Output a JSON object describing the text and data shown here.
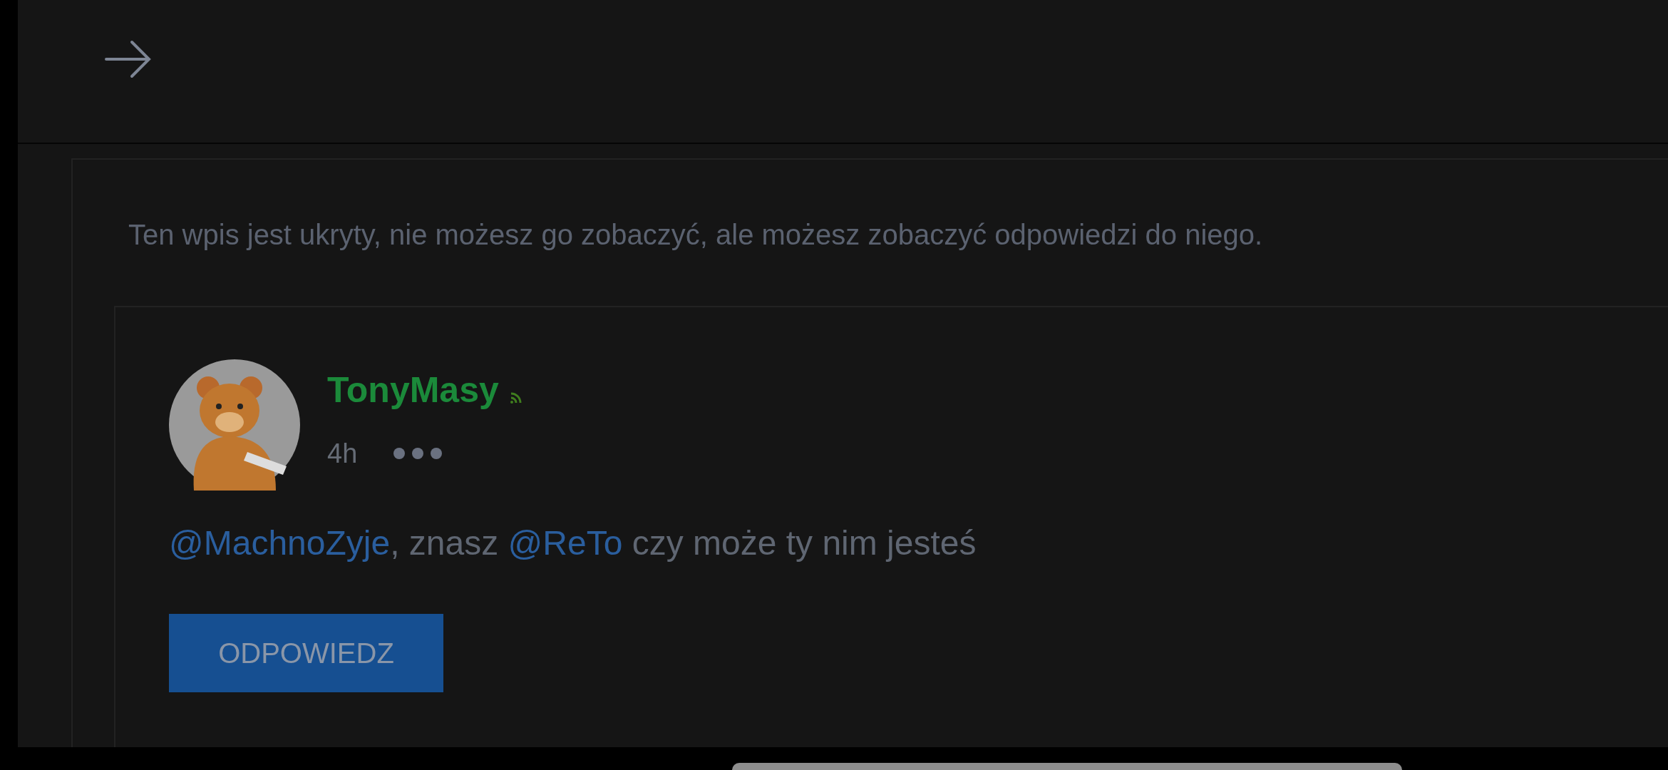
{
  "notice": "Ten wpis jest ukryty, nie możesz go zobaczyć, ale możesz zobaczyć odpowiedzi do niego.",
  "reply": {
    "author": "TonyMasy",
    "time": "4h",
    "body": [
      {
        "kind": "mention",
        "text": "@MachnoZyje"
      },
      {
        "kind": "text",
        "text": ", znasz "
      },
      {
        "kind": "mention",
        "text": "@ReTo"
      },
      {
        "kind": "text",
        "text": " czy może ty nim jesteś"
      }
    ],
    "button": "ODPOWIEDZ"
  }
}
